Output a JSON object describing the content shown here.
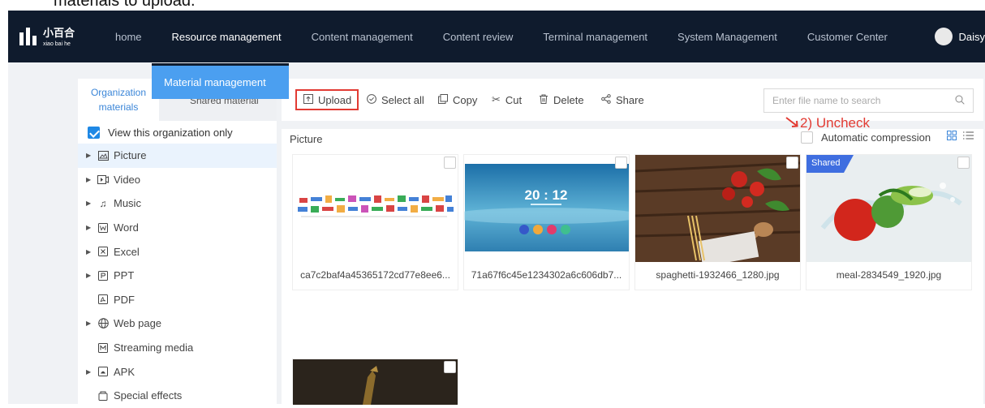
{
  "caption": "materials to upload.",
  "nav": {
    "logo_cn": "小百合",
    "logo_en": "xiao bai he",
    "items": [
      "home",
      "Resource management",
      "Content management",
      "Content review",
      "Terminal management",
      "System Management",
      "Customer Center"
    ],
    "user": "Daisy"
  },
  "dropdown": {
    "item": "Material management"
  },
  "sidebar": {
    "tab_org_line1": "Organization",
    "tab_org_line2": "materials",
    "tab_shared": "Shared material",
    "view_only": "View this organization only",
    "items": [
      {
        "label": "Picture",
        "icon": "image-icon"
      },
      {
        "label": "Video",
        "icon": "video-icon"
      },
      {
        "label": "Music",
        "icon": "music-icon"
      },
      {
        "label": "Word",
        "icon": "word-icon"
      },
      {
        "label": "Excel",
        "icon": "excel-icon"
      },
      {
        "label": "PPT",
        "icon": "ppt-icon"
      },
      {
        "label": "PDF",
        "icon": "pdf-icon"
      },
      {
        "label": "Web page",
        "icon": "globe-icon"
      },
      {
        "label": "Streaming media",
        "icon": "stream-icon"
      },
      {
        "label": "APK",
        "icon": "apk-icon"
      },
      {
        "label": "Special effects",
        "icon": "effects-icon"
      }
    ]
  },
  "toolbar": {
    "upload": "Upload",
    "select_all": "Select all",
    "copy": "Copy",
    "cut": "Cut",
    "delete": "Delete",
    "share": "Share",
    "search_placeholder": "Enter file name to search"
  },
  "content": {
    "section": "Picture",
    "annotation": "2) Uncheck",
    "auto_compression": "Automatic compression",
    "auto_compression_checked": false,
    "shared_badge": "Shared",
    "clock_text": "20 : 12",
    "files": [
      "ca7c2baf4a45365172cd77e8ee6...",
      "71a67f6c45e1234302a6c606db7...",
      "spaghetti-1932466_1280.jpg",
      "meal-2834549_1920.jpg"
    ]
  },
  "colors": {
    "nav_bg": "#0f1b2d",
    "accent": "#1e88e5",
    "highlight_red": "#e23b33",
    "dropdown_bg": "#4b9ff0"
  }
}
